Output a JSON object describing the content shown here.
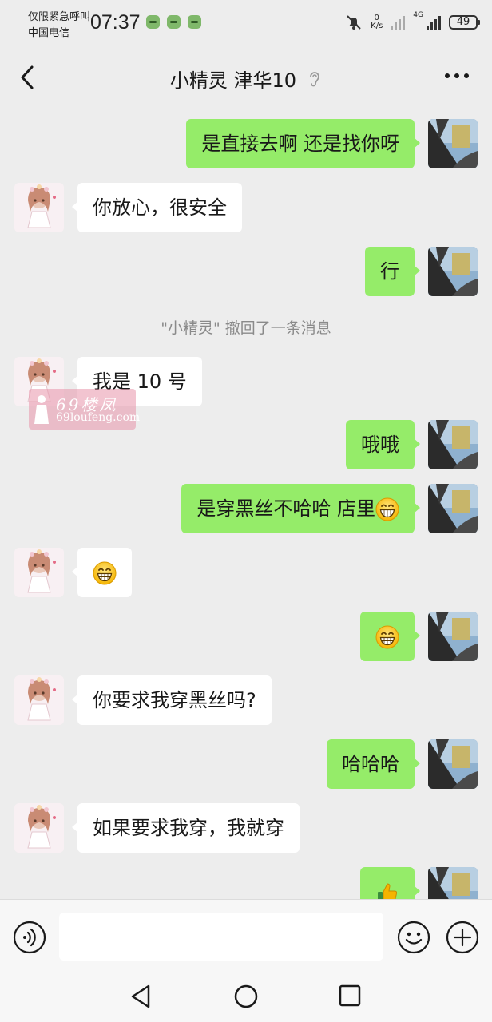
{
  "status_bar": {
    "carrier_line1": "仅限紧急呼叫",
    "carrier_line2": "中国电信",
    "time": "07:37",
    "net_speed_value": "0",
    "net_speed_unit": "K/s",
    "network_type": "4G",
    "battery": "49",
    "notification_icons": [
      "wechat-notif-icon",
      "wechat-notif-icon",
      "wechat-notif-icon"
    ]
  },
  "header": {
    "title": "小精灵 津华10",
    "back_icon": "chevron-left-icon",
    "earpiece_icon": "ear-icon",
    "more_icon": "more-dots-icon"
  },
  "messages": [
    {
      "side": "out",
      "text": "是直接去啊 还是找你呀"
    },
    {
      "side": "in",
      "text": "你放心，很安全"
    },
    {
      "side": "out",
      "text": "行"
    },
    {
      "side": "system",
      "text": "\"小精灵\" 撤回了一条消息"
    },
    {
      "side": "in",
      "text": "我是 10 号"
    },
    {
      "side": "out",
      "text": "哦哦"
    },
    {
      "side": "out",
      "text": "是穿黑丝不哈哈  店里",
      "emoji": "grin-emoji"
    },
    {
      "side": "in",
      "text": "",
      "emoji": "grin-emoji"
    },
    {
      "side": "out",
      "text": "",
      "emoji": "grin-emoji"
    },
    {
      "side": "in",
      "text": "你要求我穿黑丝吗?"
    },
    {
      "side": "out",
      "text": "哈哈哈"
    },
    {
      "side": "in",
      "text": "如果要求我穿，我就穿"
    },
    {
      "side": "out",
      "text": "",
      "emoji": "thumbs-up-emoji"
    }
  ],
  "watermark": {
    "line1": "69楼凤",
    "line2": "69loufeng.com"
  },
  "input_bar": {
    "voice_icon": "voice-icon",
    "input_value": "",
    "emoji_icon": "smile-icon",
    "plus_icon": "plus-icon"
  },
  "nav_bar": {
    "back_icon": "triangle-back-icon",
    "home_icon": "circle-home-icon",
    "recent_icon": "square-recent-icon"
  },
  "colors": {
    "background": "#ededed",
    "outgoing_bubble": "#95ec69",
    "incoming_bubble": "#ffffff",
    "system_text": "#8a8a8a"
  }
}
